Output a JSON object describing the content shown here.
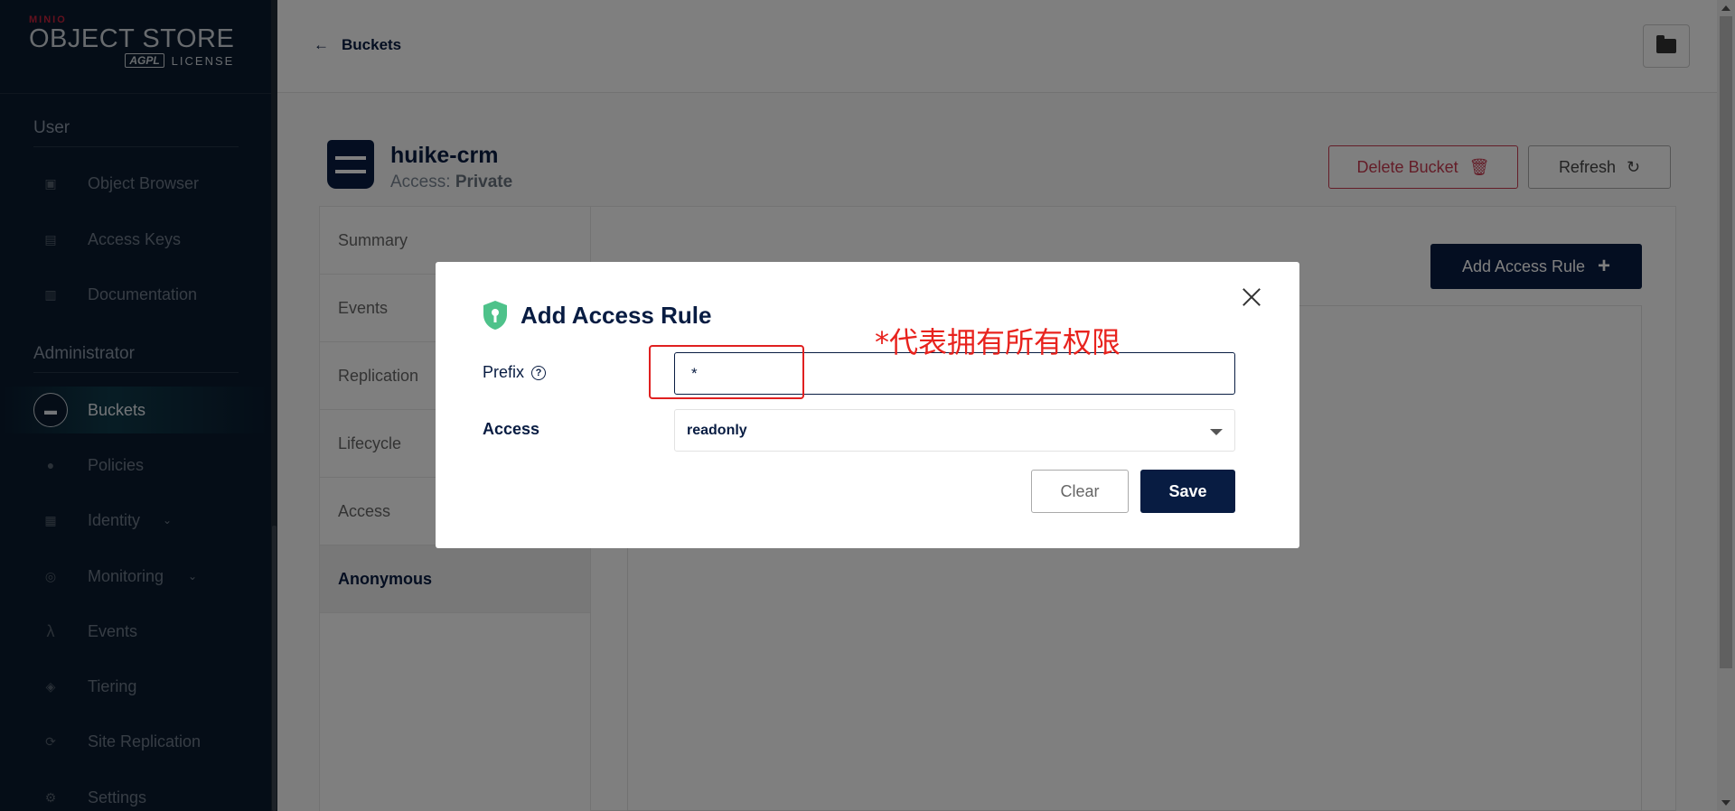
{
  "logo": {
    "brand": "MINIO",
    "product": "OBJECT STORE",
    "edition": "AGPL",
    "license": "LICENSE"
  },
  "sidebar": {
    "sections": [
      {
        "title": "User",
        "items": [
          {
            "label": "Object Browser",
            "icon": "object-browser-icon"
          },
          {
            "label": "Access Keys",
            "icon": "access-keys-icon"
          },
          {
            "label": "Documentation",
            "icon": "documentation-icon"
          }
        ]
      },
      {
        "title": "Administrator",
        "items": [
          {
            "label": "Buckets",
            "icon": "bucket-icon",
            "active": true
          },
          {
            "label": "Policies",
            "icon": "policies-icon"
          },
          {
            "label": "Identity",
            "icon": "identity-icon",
            "expandable": true
          },
          {
            "label": "Monitoring",
            "icon": "monitoring-icon",
            "expandable": true
          },
          {
            "label": "Events",
            "icon": "lambda-icon"
          },
          {
            "label": "Tiering",
            "icon": "tiering-icon"
          },
          {
            "label": "Site Replication",
            "icon": "site-replication-icon"
          },
          {
            "label": "Settings",
            "icon": "settings-icon"
          }
        ]
      }
    ]
  },
  "topbar": {
    "back_label": "Buckets"
  },
  "bucket": {
    "name": "huike-crm",
    "access_label": "Access:",
    "access_value": "Private"
  },
  "actions": {
    "delete_label": "Delete Bucket",
    "refresh_label": "Refresh",
    "add_rule_label": "Add Access Rule"
  },
  "tabs": [
    "Summary",
    "Events",
    "Replication",
    "Lifecycle",
    "Access",
    "Anonymous"
  ],
  "active_tab": "Anonymous",
  "modal": {
    "title": "Add Access Rule",
    "prefix_label": "Prefix",
    "prefix_value": "*",
    "access_label": "Access",
    "access_value": "readonly",
    "clear_label": "Clear",
    "save_label": "Save"
  },
  "annotation": {
    "note": "*代表拥有所有权限",
    "color": "#e8231e"
  },
  "colors": {
    "navy": "#081c42",
    "danger": "#c83b51",
    "sidebar_bg": "#0a1a2e",
    "shield_green": "#4ec28a"
  }
}
